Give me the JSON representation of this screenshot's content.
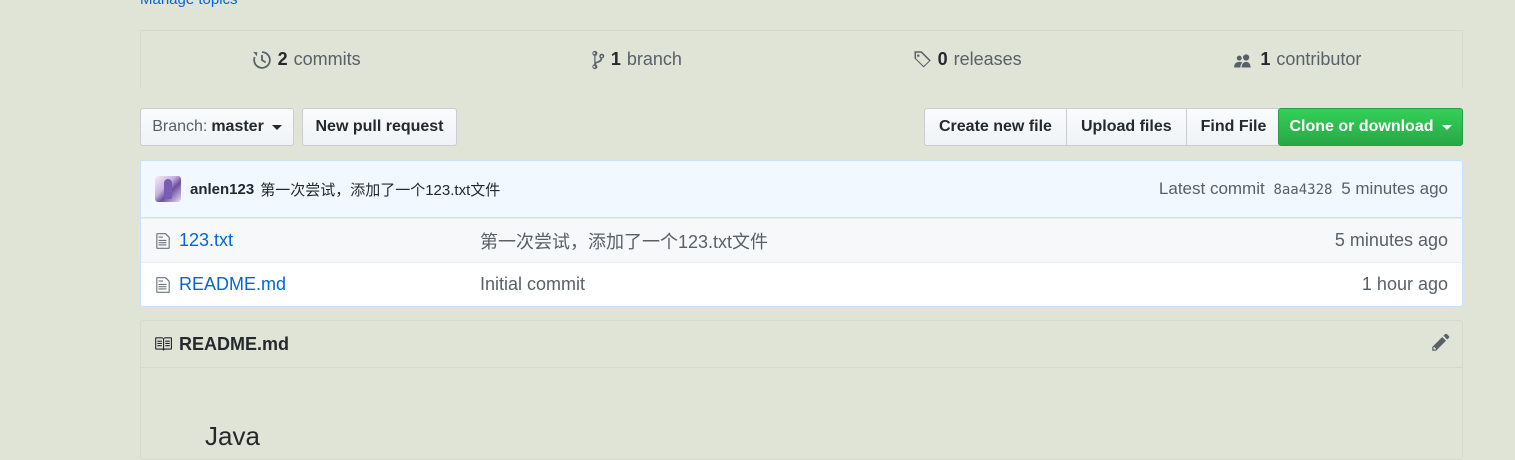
{
  "repo": {
    "manage_topics": "Manage topics"
  },
  "summary": {
    "commits": {
      "count": "2",
      "label": "commits",
      "icon": "history-icon"
    },
    "branches": {
      "count": "1",
      "label": "branch",
      "icon": "branch-icon"
    },
    "releases": {
      "count": "0",
      "label": "releases",
      "icon": "tag-icon"
    },
    "contributors": {
      "count": "1",
      "label": "contributor",
      "icon": "people-icon"
    }
  },
  "toolbar": {
    "branch_prefix": "Branch:",
    "branch_name": "master",
    "new_pull_request": "New pull request",
    "create_new_file": "Create new file",
    "upload_files": "Upload files",
    "find_file": "Find File",
    "clone_or_download": "Clone or download"
  },
  "latest_commit": {
    "author": "anlen123",
    "message": "第一次尝试，添加了一个123.txt文件",
    "prefix": "Latest commit",
    "sha": "8aa4328",
    "age": "5 minutes ago"
  },
  "files": [
    {
      "name": "123.txt",
      "message": "第一次尝试，添加了一个123.txt文件",
      "age": "5 minutes ago",
      "icon": "file-icon"
    },
    {
      "name": "README.md",
      "message": "Initial commit",
      "age": "1 hour ago",
      "icon": "file-icon"
    }
  ],
  "readme": {
    "title": "README.md",
    "body_text": "Java"
  },
  "colors": {
    "accent_link": "#0366d6",
    "primary_button": "#28a745",
    "commit_bar": "#f1f8ff"
  }
}
